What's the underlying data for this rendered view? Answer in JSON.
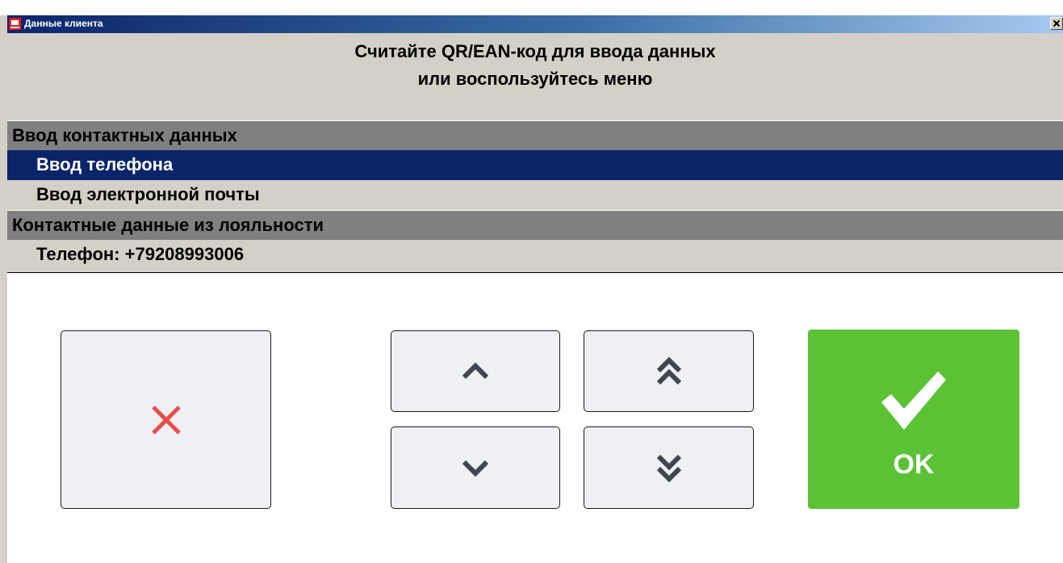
{
  "window": {
    "title": "Данные клиента",
    "accent_color": "#0a246a"
  },
  "prompt": {
    "line1": "Считайте QR/EAN-код для ввода данных",
    "line2": "или воспользуйтесь меню"
  },
  "menu": {
    "rows": [
      {
        "type": "header",
        "label": "Ввод контактных данных"
      },
      {
        "type": "item",
        "label": "Ввод телефона",
        "selected": true
      },
      {
        "type": "item",
        "label": "Ввод электронной почты"
      },
      {
        "type": "header",
        "label": "Контактные данные из лояльности"
      },
      {
        "type": "item",
        "label": "Телефон: +79208993006"
      }
    ]
  },
  "buttons": {
    "cancel": {
      "icon": "close-icon",
      "color": "#e94c4c"
    },
    "up": {
      "icon": "chevron-up-icon"
    },
    "page_up": {
      "icon": "double-chevron-up-icon"
    },
    "down": {
      "icon": "chevron-down-icon"
    },
    "page_down": {
      "icon": "double-chevron-down-icon"
    },
    "ok": {
      "icon": "checkmark-icon",
      "label": "OK",
      "color": "#5bc236"
    }
  }
}
